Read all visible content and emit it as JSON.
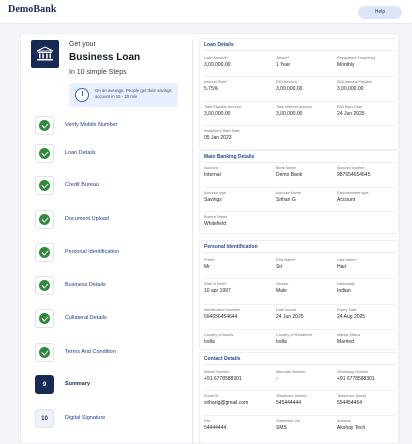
{
  "app": {
    "brand": "DemoBank",
    "help_label": "Help"
  },
  "hero": {
    "eyebrow": "Get your",
    "title": "Business Loan",
    "subtitle": "In 10 simple Steps",
    "tip": "On an average, People get their savings account in 15 - 20 min"
  },
  "steps": [
    {
      "num": "1",
      "label": "Verify Mobile Number",
      "state": "done"
    },
    {
      "num": "2",
      "label": "Loan Details",
      "state": "done"
    },
    {
      "num": "3",
      "label": "Credit Bureau",
      "state": "done"
    },
    {
      "num": "4",
      "label": "Document Upload",
      "state": "done"
    },
    {
      "num": "5",
      "label": "Personal Identification",
      "state": "done"
    },
    {
      "num": "6",
      "label": "Business Details",
      "state": "done"
    },
    {
      "num": "7",
      "label": "Collateral Details",
      "state": "done"
    },
    {
      "num": "8",
      "label": "Terms And Condition",
      "state": "done"
    },
    {
      "num": "9",
      "label": "Summary",
      "state": "current"
    },
    {
      "num": "10",
      "label": "Digital Signature",
      "state": "pending"
    }
  ],
  "loan": {
    "title": "Loan Details",
    "fields": [
      {
        "label": "Loan Amount*",
        "value": "3,00,000.00"
      },
      {
        "label": "Tenure*",
        "value": "1 Year"
      },
      {
        "label": "Repayment Frequency",
        "value": "Monthly"
      },
      {
        "label": "Interest Rate*",
        "value": "5.75%"
      },
      {
        "label": "EMI Amount",
        "value": "3,00,000.00"
      },
      {
        "label": "EMI Interest Payable",
        "value": "3,00,000.00"
      },
      {
        "label": "Total Payable Amount",
        "value": "3,00,000.00"
      },
      {
        "label": "Total Interest Amount",
        "value": "3,00,000.00"
      },
      {
        "label": "EMI Start Date",
        "value": "24 Jun 2025"
      },
      {
        "label": "Instalment Start Date",
        "value": "05 Jan 2023"
      }
    ]
  },
  "banking": {
    "title": "Main Banking Details",
    "fields": [
      {
        "label": "Account",
        "value": "Internal"
      },
      {
        "label": "Bank Name",
        "value": "Demo Bank"
      },
      {
        "label": "Account number",
        "value": "987654654545"
      },
      {
        "label": "Account type",
        "value": "Savings"
      },
      {
        "label": "Account Name",
        "value": "Srihari G"
      },
      {
        "label": "Disbursement type",
        "value": "Account"
      },
      {
        "label": "Branch Name",
        "value": "Whitefield"
      }
    ]
  },
  "personal": {
    "title": "Personal Identification",
    "fields": [
      {
        "label": "Prefix*",
        "value": "Mr"
      },
      {
        "label": "First Name*",
        "value": "Sri"
      },
      {
        "label": "Last Name*",
        "value": "Hari"
      },
      {
        "label": "Date of Birth*",
        "value": "10 apr 1997"
      },
      {
        "label": "Gender",
        "value": "Male"
      },
      {
        "label": "Nationality",
        "value": "Indian"
      },
      {
        "label": "Identification Number",
        "value": "594656454644"
      },
      {
        "label": "Date Issued",
        "value": "24 Jun 2025"
      },
      {
        "label": "Expiry Date",
        "value": "24 Aug 2025"
      },
      {
        "label": "Country of issues",
        "value": "India"
      },
      {
        "label": "Country of Residence",
        "value": "India"
      },
      {
        "label": "Marital Status",
        "value": "Married"
      }
    ]
  },
  "contact": {
    "title": "Contact Details",
    "fields": [
      {
        "label": "Mobile Number",
        "value": "+91 6778588301"
      },
      {
        "label": "Alternate Number",
        "value": "-"
      },
      {
        "label": "Whatsapp Number",
        "value": "+91 6778588301"
      },
      {
        "label": "Email ID",
        "value": "sriharig@gmail.com"
      },
      {
        "label": "Telephone (home)",
        "value": "545444444"
      },
      {
        "label": "Telephone (work)",
        "value": "554454464"
      },
      {
        "label": "Fax",
        "value": "54444444"
      },
      {
        "label": "Statement Via",
        "value": "SMS"
      },
      {
        "label": "Address",
        "value": "Akshay Tech"
      }
    ]
  }
}
